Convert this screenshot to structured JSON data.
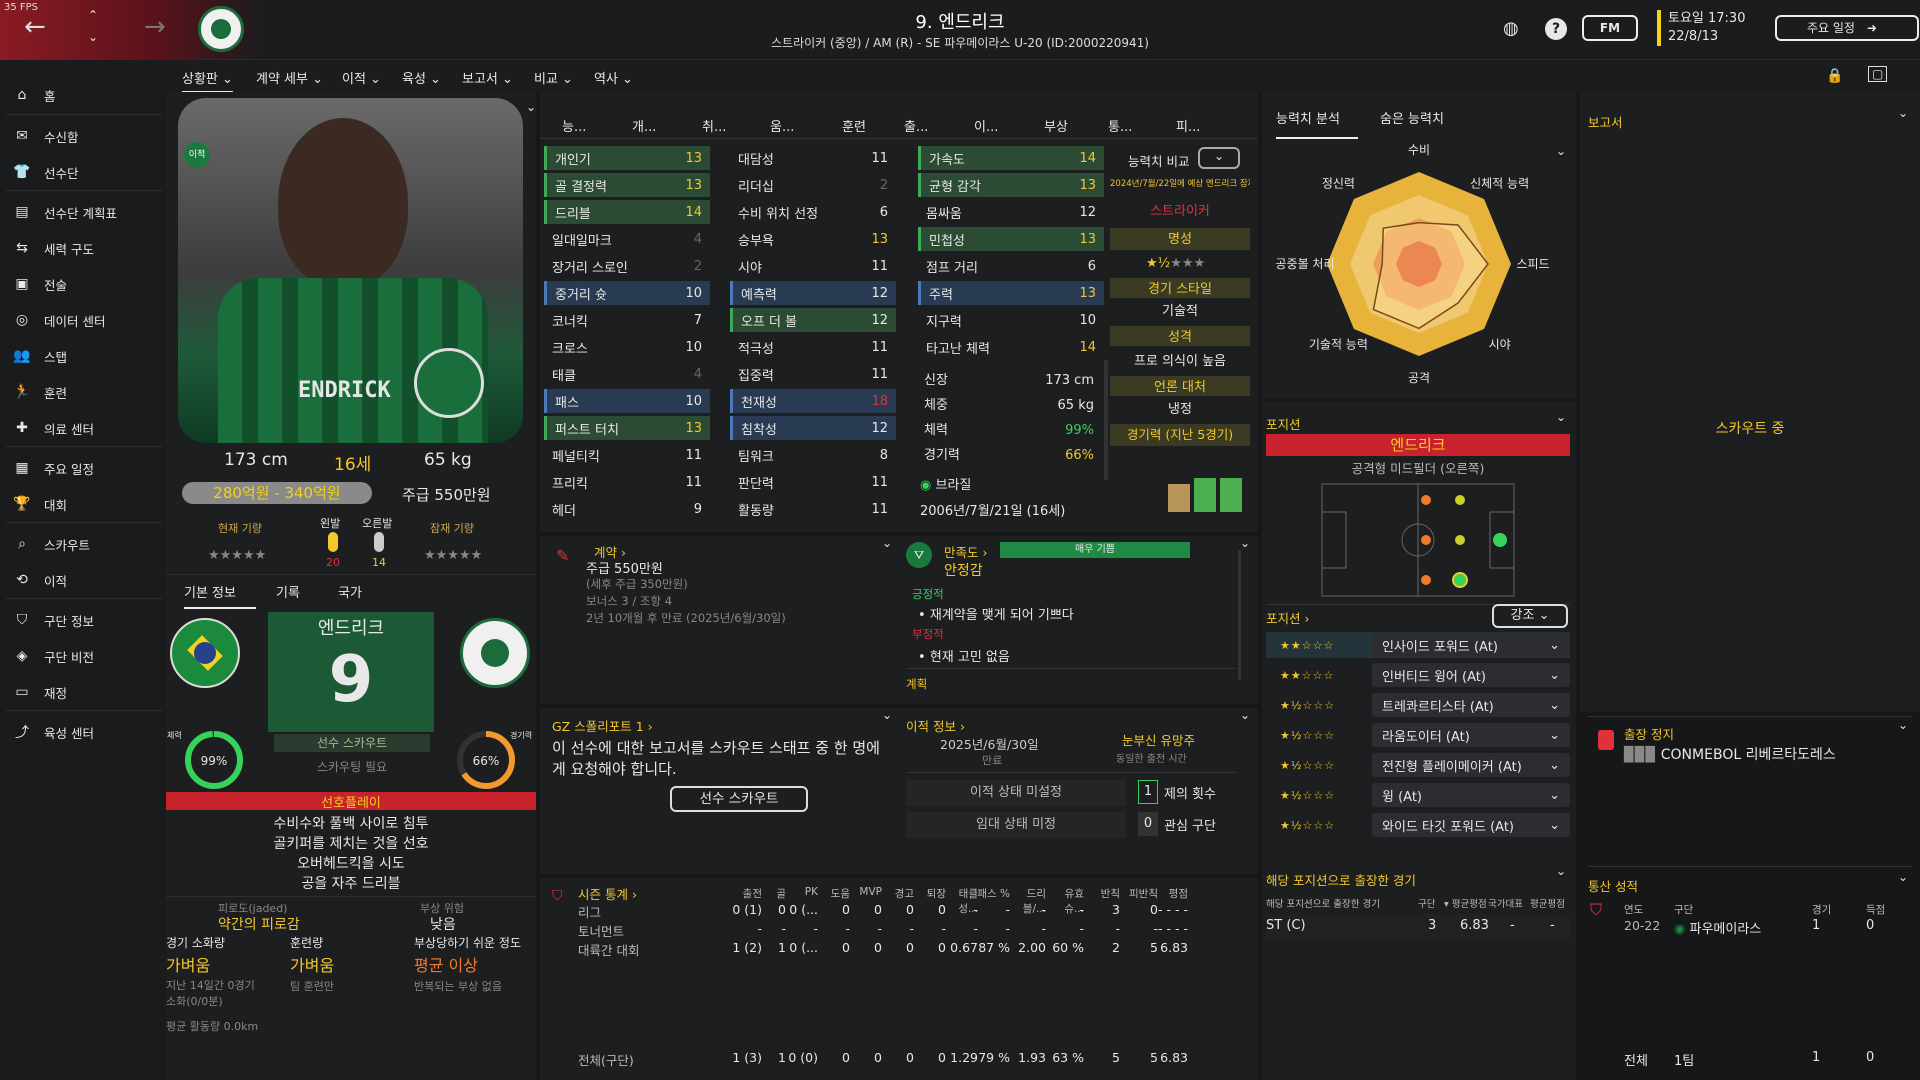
{
  "fps": "35 FPS",
  "header": {
    "title": "9. 엔드리크",
    "subtitle": "스트라이커 (중앙) / AM (R) - SE 파우메이라스 U-20 (ID:2000220941)",
    "fm_label": "FM",
    "date_line1": "토요일 17:30",
    "date_line2": "22/8/13",
    "schedule_btn": "주요 일정"
  },
  "sidebar": {
    "items": [
      "홈",
      "수신함",
      "선수단",
      "선수단 계획표",
      "세력 구도",
      "전술",
      "데이터 센터",
      "스탭",
      "훈련",
      "의료 센터",
      "주요 일정",
      "대회",
      "스카우트",
      "이적",
      "구단 정보",
      "구단 비전",
      "재정",
      "육성 센터"
    ]
  },
  "menu": {
    "items": [
      "상황판",
      "계약 세부",
      "이적",
      "육성",
      "보고서",
      "비교",
      "역사"
    ]
  },
  "profile": {
    "shirt_name": "ENDRICK",
    "badge": "이적",
    "height": "173 cm",
    "age": "16세",
    "weight": "65 kg",
    "value": "280억원 - 340억원",
    "wage": "주급 550만원",
    "current_ability": "현재 기량",
    "potential_ability": "잠재 기량",
    "left_foot": "왼발",
    "right_foot": "오른발",
    "left_foot_val": "20",
    "right_foot_val": "14",
    "tabs": [
      "기본 정보",
      "기록",
      "국가"
    ],
    "card_name": "엔드리크",
    "card_number": "9",
    "scout_btn": "선수 스카우트",
    "scout_needed": "스카우팅 필요",
    "fitness_label": "체력",
    "fitness": "99%",
    "match_label": "경기력",
    "match": "66%",
    "preferred_title": "선호플레이",
    "preferred": [
      "수비수와 풀백 사이로 침투",
      "골키퍼를 제치는 것을 선호",
      "오버헤드킥을 시도",
      "공을 자주 드리블"
    ],
    "fatigue_label": "피로도(jaded)",
    "fatigue_val": "약간의 피로감",
    "injury_risk_label": "부상 위험",
    "injury_risk_val": "낮음",
    "load_label": "경기 소화량",
    "load_val": "가벼움",
    "training_label": "훈련량",
    "training_val": "가벼움",
    "proneness_label": "부상당하기 쉬운 정도",
    "proneness_val": "평균 이상",
    "load_note1": "지난 14일간 0경기",
    "load_note2": "소화(0/0분)",
    "training_note": "팀 훈련만",
    "proneness_note": "반복되는 부상 없음",
    "distance": "평균 활동량 0.0km"
  },
  "attr_headers": [
    "능...",
    "개...",
    "취...",
    "움...",
    "훈련",
    "출...",
    "이...",
    "부상",
    "통...",
    "피..."
  ],
  "attributes": {
    "technical": [
      {
        "name": "개인기",
        "value": "13",
        "hl": "green"
      },
      {
        "name": "골 결정력",
        "value": "13",
        "hl": "green"
      },
      {
        "name": "드리블",
        "value": "14",
        "hl": "green"
      },
      {
        "name": "일대일마크",
        "value": "4",
        "hl": ""
      },
      {
        "name": "장거리 스로인",
        "value": "2",
        "hl": ""
      },
      {
        "name": "중거리 슛",
        "value": "10",
        "hl": "blue"
      },
      {
        "name": "코너킥",
        "value": "7",
        "hl": ""
      },
      {
        "name": "크로스",
        "value": "10",
        "hl": ""
      },
      {
        "name": "태클",
        "value": "4",
        "hl": ""
      },
      {
        "name": "패스",
        "value": "10",
        "hl": "blue"
      },
      {
        "name": "퍼스트 터치",
        "value": "13",
        "hl": "green"
      },
      {
        "name": "페널티킥",
        "value": "11",
        "hl": ""
      },
      {
        "name": "프리킥",
        "value": "11",
        "hl": ""
      },
      {
        "name": "헤더",
        "value": "9",
        "hl": ""
      }
    ],
    "mental": [
      {
        "name": "대담성",
        "value": "11",
        "hl": ""
      },
      {
        "name": "리더십",
        "value": "2",
        "hl": ""
      },
      {
        "name": "수비 위치 선정",
        "value": "6",
        "hl": ""
      },
      {
        "name": "승부욕",
        "value": "13",
        "hl": ""
      },
      {
        "name": "시야",
        "value": "11",
        "hl": ""
      },
      {
        "name": "예측력",
        "value": "12",
        "hl": "blue"
      },
      {
        "name": "오프 더 볼",
        "value": "12",
        "hl": "green"
      },
      {
        "name": "적극성",
        "value": "11",
        "hl": ""
      },
      {
        "name": "집중력",
        "value": "11",
        "hl": ""
      },
      {
        "name": "천재성",
        "value": "18",
        "hl": "blue"
      },
      {
        "name": "침착성",
        "value": "12",
        "hl": "blue"
      },
      {
        "name": "팀워크",
        "value": "8",
        "hl": ""
      },
      {
        "name": "판단력",
        "value": "11",
        "hl": ""
      },
      {
        "name": "활동량",
        "value": "11",
        "hl": ""
      }
    ],
    "physical": [
      {
        "name": "가속도",
        "value": "14",
        "hl": "green"
      },
      {
        "name": "균형 감각",
        "value": "13",
        "hl": "green"
      },
      {
        "name": "몸싸움",
        "value": "12",
        "hl": ""
      },
      {
        "name": "민첩성",
        "value": "13",
        "hl": "green"
      },
      {
        "name": "점프 거리",
        "value": "6",
        "hl": ""
      },
      {
        "name": "주력",
        "value": "13",
        "hl": "blue"
      },
      {
        "name": "지구력",
        "value": "10",
        "hl": ""
      },
      {
        "name": "타고난 체력",
        "value": "14",
        "hl": ""
      }
    ]
  },
  "bio": [
    {
      "label": "신장",
      "value": "173 cm"
    },
    {
      "label": "체중",
      "value": "65 kg"
    },
    {
      "label": "체력",
      "value": "99%"
    },
    {
      "label": "경기력",
      "value": "66%"
    }
  ],
  "nationality": "브라질",
  "dob": "2006년/7월/21일 (16세)",
  "side_info": {
    "compare_label": "능력치 비교",
    "compare_note": "2024년/7월/22일에 예상 엔드리크 잠재력",
    "role": "스트라이커",
    "fame_label": "명성",
    "style_label": "경기 스타일",
    "style_val": "기술적",
    "personality_label": "성격",
    "personality_val": "프로 의식이 높음",
    "media_label": "언론 대처",
    "media_val": "냉정",
    "form_label": "경기력 (지난 5경기)"
  },
  "contract": {
    "title": "계약",
    "wage": "주급 550만원",
    "tax": "(세후 주급 350만원)",
    "bonus": "보너스 3 / 조항 4",
    "expiry": "2년 10개월 후 만료 (2025년/6월/30일)"
  },
  "satisfaction": {
    "title": "만족도",
    "level_bar": "매우 기쁨",
    "status": "안정감",
    "positive_label": "긍정적",
    "positive": "재계약을 맺게 되어 기쁘다",
    "negative_label": "부정적",
    "negative": "현재 고민 없음",
    "promise_label": "계획"
  },
  "scout_report": {
    "title": "GZ 스폴리포트 1",
    "text": "이 선수에 대한 보고서를 스카우트 스태프 중 한 명에게 요청해야 합니다.",
    "button": "선수 스카우트"
  },
  "transfer": {
    "title": "이적 정보",
    "expiry_date": "2025년/6월/30일",
    "expiry_label": "만료",
    "homegrown": "눈부신 유망주",
    "homegrown_note": "동일한 출전 시간",
    "status1": "이적 상태 미설정",
    "status2": "임대 상태 미정",
    "offers_count": "1",
    "offers_label": "제의 횟수",
    "interest_count": "0",
    "interest_label": "관심 구단"
  },
  "season_stats": {
    "title": "시즌 통계",
    "headers": [
      "출전",
      "골",
      "PK",
      "도움",
      "MVP",
      "경고",
      "퇴장",
      "태클 성...",
      "패스 %",
      "드리블/...",
      "유효 슈...",
      "반칙",
      "피반칙",
      "평점"
    ],
    "rows": [
      {
        "name": "리그",
        "vals": [
          "0 (1)",
          "0",
          "0 (...",
          "0",
          "0",
          "0",
          "0",
          "-",
          "-",
          "-",
          "-",
          "3",
          "0",
          "- - - -"
        ]
      },
      {
        "name": "토너먼트",
        "vals": [
          "-",
          "-",
          "-",
          "-",
          "-",
          "-",
          "-",
          "-",
          "-",
          "-",
          "-",
          "-",
          "-",
          "- - - -"
        ]
      },
      {
        "name": "대륙간 대회",
        "vals": [
          "1 (2)",
          "1",
          "0 (...",
          "0",
          "0",
          "0",
          "0",
          "0.67",
          "87 %",
          "2.00",
          "60 %",
          "2",
          "5",
          "6.83"
        ]
      }
    ],
    "total_name": "전체(구단)",
    "total": [
      "1 (3)",
      "1",
      "0 (0)",
      "0",
      "0",
      "0",
      "0",
      "1.29",
      "79 %",
      "1.93",
      "63 %",
      "5",
      "5",
      "6.83"
    ]
  },
  "radar": {
    "tabs": [
      "능력치 분석",
      "숨은 능력치"
    ],
    "labels": [
      "수비",
      "신체적 능력",
      "스피드",
      "시야",
      "공격",
      "기술적 능력",
      "공중볼 처리",
      "정신력"
    ],
    "values": [
      0.45,
      0.6,
      0.75,
      0.6,
      0.7,
      0.7,
      0.4,
      0.55
    ]
  },
  "position": {
    "title": "포지션",
    "player": "엔드리크",
    "role": "공격형 미드필더 (오른쪽)",
    "list_title": "포지션",
    "filter": "강조",
    "roles": [
      {
        "stars": "★★☆☆☆",
        "name": "인사이드 포워드 (At)"
      },
      {
        "stars": "★★☆☆☆",
        "name": "인버티드 윙어 (At)"
      },
      {
        "stars": "★½☆☆☆",
        "name": "트레콰르티스타 (At)"
      },
      {
        "stars": "★½☆☆☆",
        "name": "라움도이터 (At)"
      },
      {
        "stars": "★½☆☆☆",
        "name": "전진형 플레이메이커 (At)"
      },
      {
        "stars": "★½☆☆☆",
        "name": "윙 (At)"
      },
      {
        "stars": "★½☆☆☆",
        "name": "와이드 타깃 포워드 (At)"
      }
    ],
    "played_title": "해당 포지션으로 출장한 경기",
    "played_headers": [
      "해당 포지션으로 출장한 경기",
      "구단",
      "평균평점",
      "국가대표",
      "평균평점"
    ],
    "played_row": {
      "pos": "ST (C)",
      "club": "3",
      "avg": "6.83",
      "intl": "-",
      "intl_avg": "-"
    }
  },
  "report": {
    "title": "보고서",
    "status": "스카우트 중"
  },
  "suspension": {
    "title": "출장 정지",
    "text": "CONMEBOL 리베르타도레스"
  },
  "career": {
    "title": "통산 성적",
    "headers": [
      "연도",
      "구단",
      "경기",
      "득점"
    ],
    "row": {
      "year": "20-22",
      "club": "파우메이라스",
      "apps": "1",
      "goals": "0"
    },
    "total_label": "전체",
    "total_club": "1팀",
    "total_apps": "1",
    "total_goals": "0"
  },
  "colors": {
    "green": "#35d35a",
    "yellow": "#f2c82c",
    "red": "#e0313a",
    "brazil_green": "#1c8a3c",
    "radar": "#e8b33a"
  }
}
